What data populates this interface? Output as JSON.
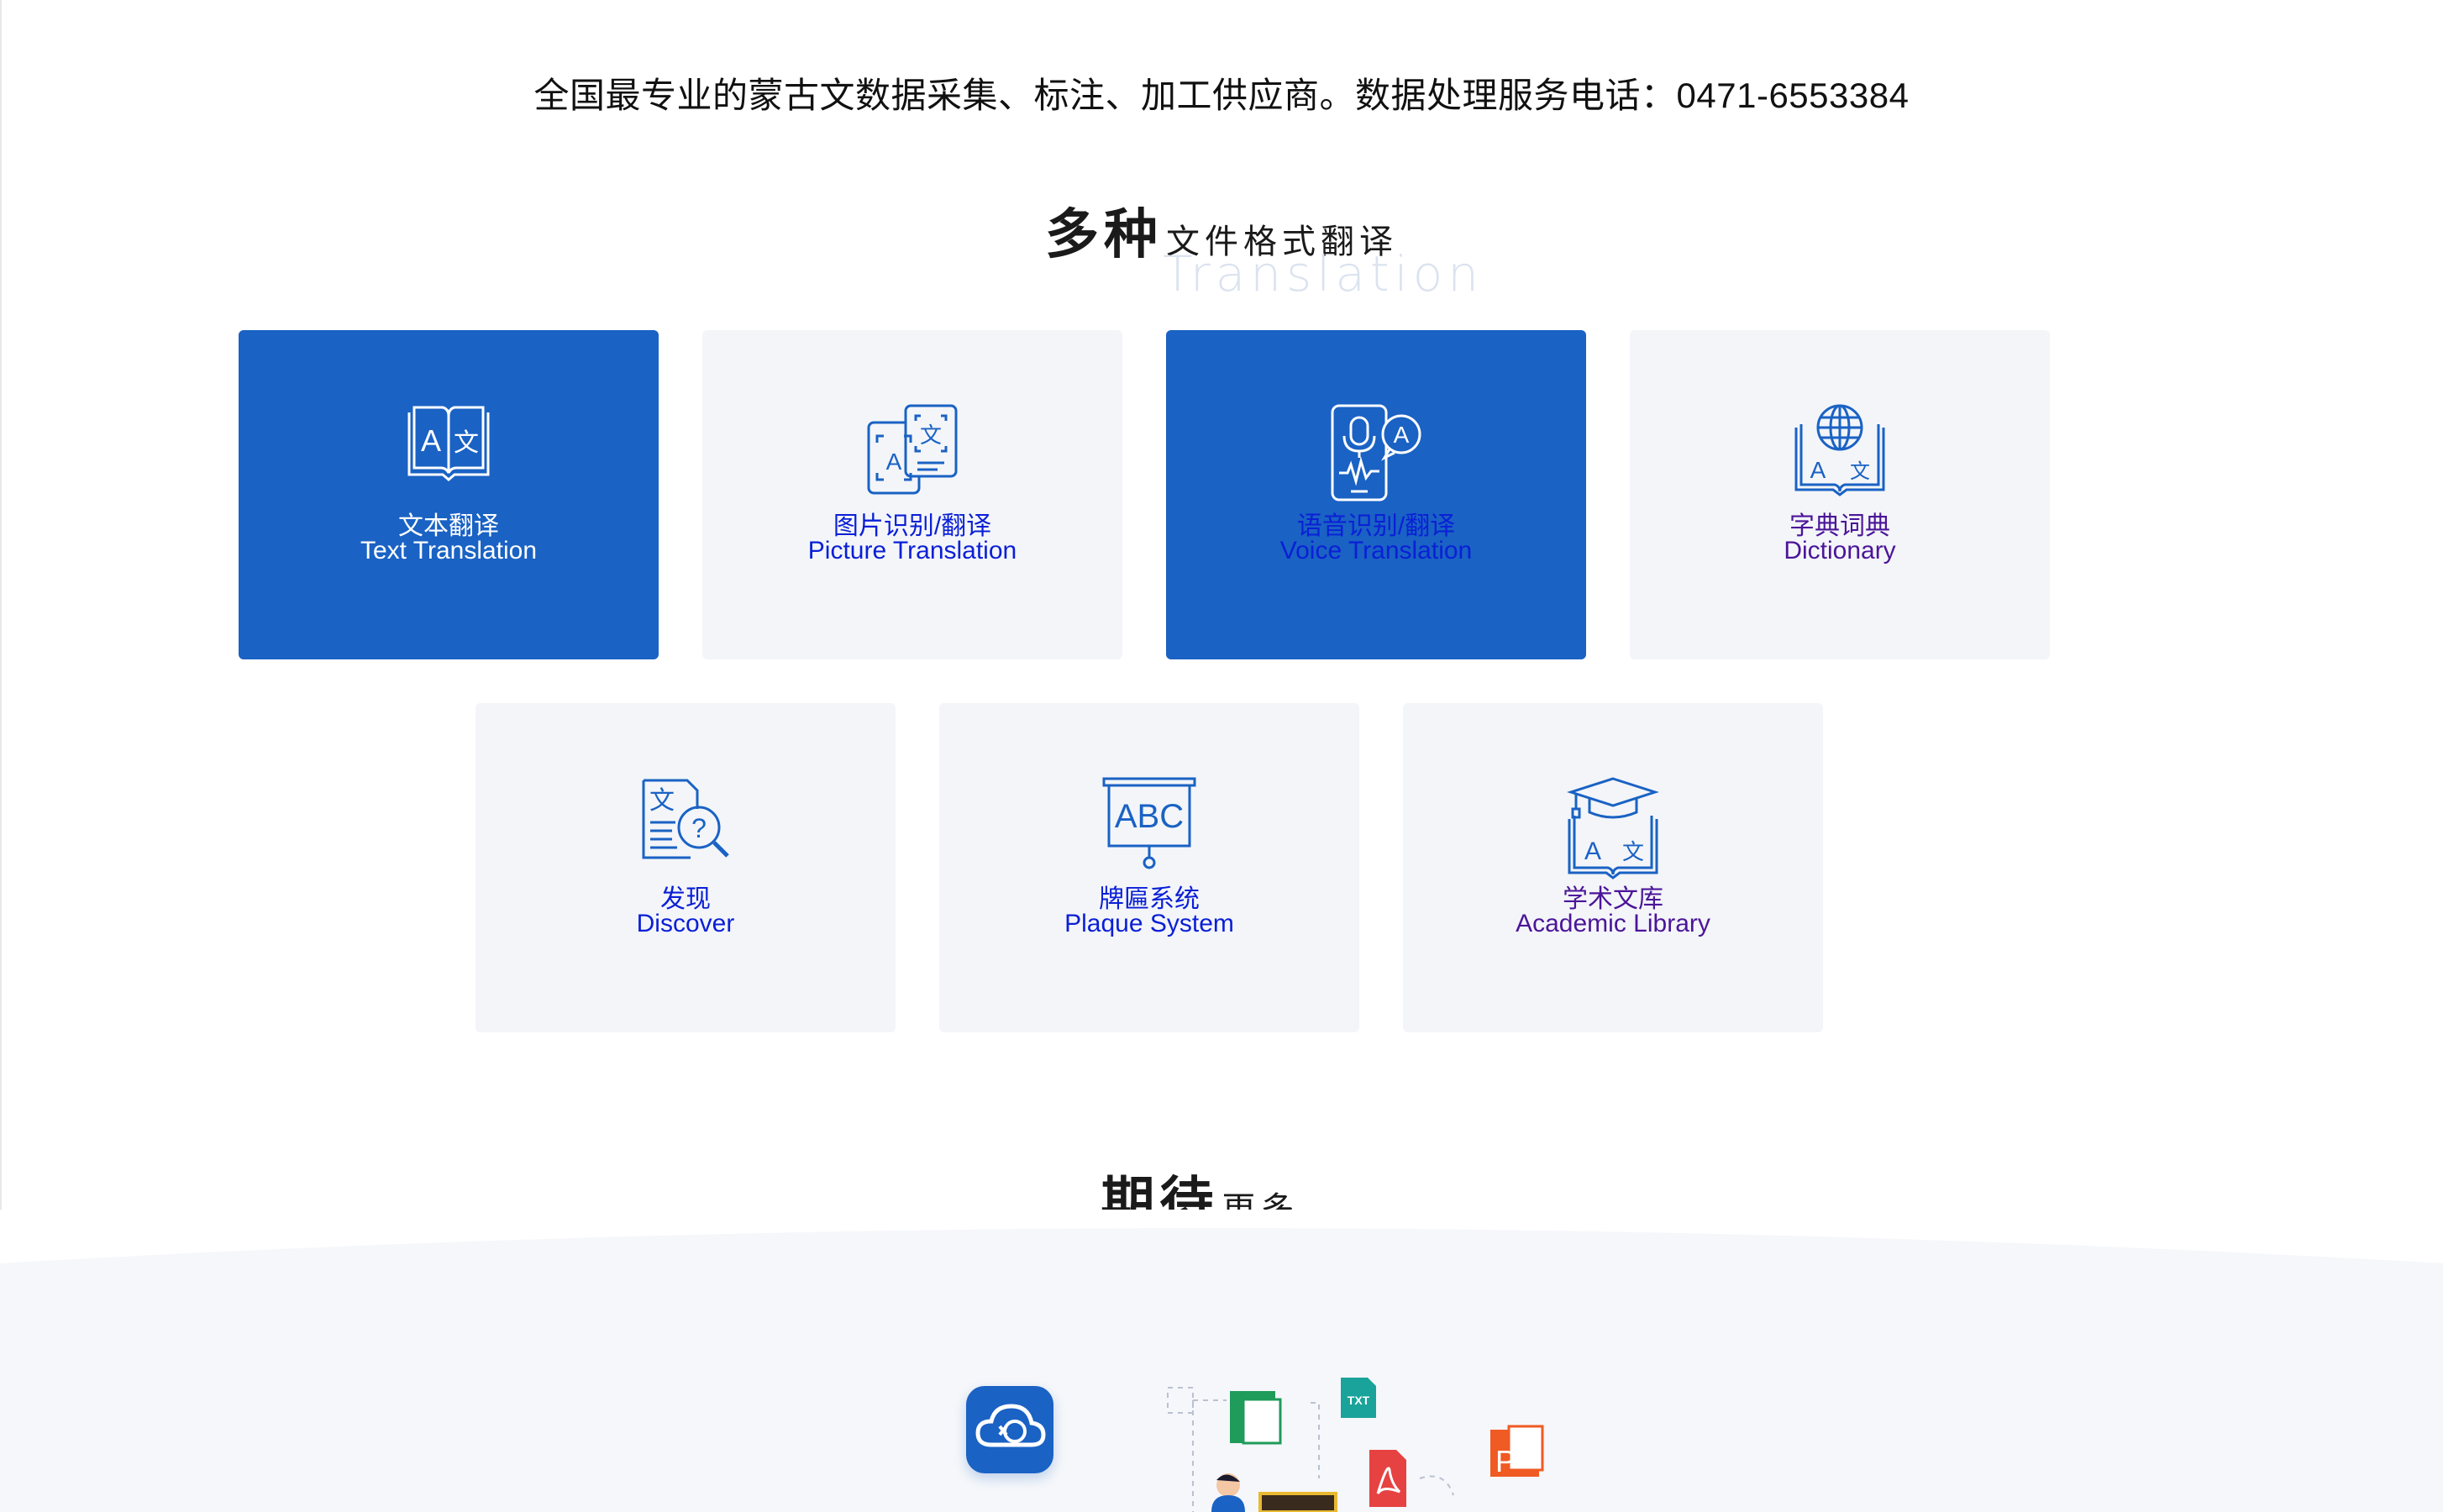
{
  "banner": "全国最专业的蒙古文数据采集、标注、加工供应商。数据处理服务电话：0471-6553384",
  "section1": {
    "big": "多种",
    "small": "文件格式翻译",
    "subtitle": "Translation"
  },
  "cards": [
    {
      "cn": "文本翻译",
      "en": "Text Translation",
      "active": true,
      "icon": "book-translate-icon"
    },
    {
      "cn": "图片识别/翻译",
      "en": "Picture Translation",
      "active": false,
      "icon": "image-translate-icon"
    },
    {
      "cn": "语音识别/翻译",
      "en": "Voice Translation",
      "active": true,
      "icon": "voice-translate-icon"
    },
    {
      "cn": "字典词典",
      "en": "Dictionary",
      "active": false,
      "icon": "dictionary-icon"
    },
    {
      "cn": "发现",
      "en": "Discover",
      "active": false,
      "icon": "discover-icon"
    },
    {
      "cn": "牌匾系统",
      "en": "Plaque System",
      "active": false,
      "icon": "plaque-icon"
    },
    {
      "cn": "学术文库",
      "en": "Academic Library",
      "active": false,
      "icon": "academic-library-icon"
    }
  ],
  "section2": {
    "big": "期待",
    "small": "更多..."
  },
  "footer": {
    "file_icons": [
      "excel-icon",
      "txt-icon",
      "pdf-icon",
      "ppt-icon"
    ],
    "txt_label": "TXT"
  },
  "colors": {
    "accent": "#1a62c4",
    "card_bg": "#f3f5f9",
    "link": "#0a1fd6",
    "visited": "#4b1598"
  }
}
